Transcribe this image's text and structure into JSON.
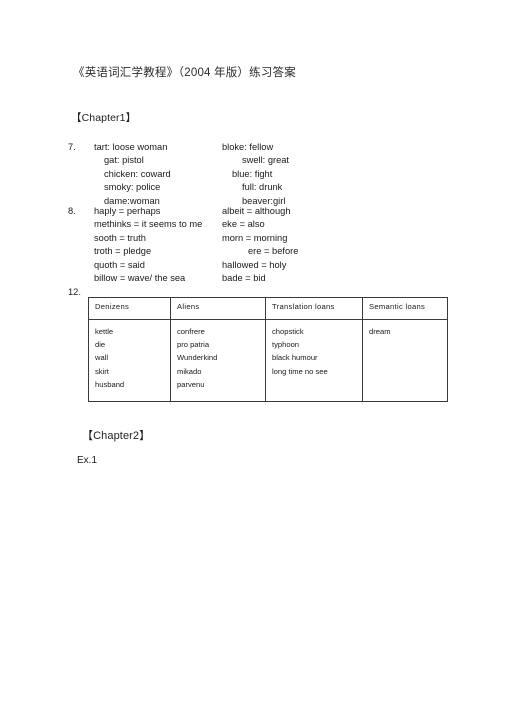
{
  "document": {
    "title": "《英语词汇学教程》（2004 年版）练习答案"
  },
  "chapter1": {
    "heading": "【Chapter1】",
    "exercises": [
      {
        "number": "7.",
        "rows": [
          {
            "left": "tart: loose woman",
            "left_indent": 0,
            "right": "bloke: fellow",
            "right_indent": 0
          },
          {
            "left": "gat: pistol",
            "left_indent": 1,
            "right": "swell: great",
            "right_indent": 1
          },
          {
            "left": "chicken: coward",
            "left_indent": 1,
            "right": "blue: fight",
            "right_indent": 0
          },
          {
            "left": "smoky: police",
            "left_indent": 1,
            "right": "full: drunk",
            "right_indent": 1
          },
          {
            "left": "dame:woman",
            "left_indent": 1,
            "right": "beaver:girl",
            "right_indent": 1
          }
        ]
      },
      {
        "number": "8.",
        "rows": [
          {
            "left": "haply = perhaps",
            "left_indent": 0,
            "right": "albeit = although",
            "right_indent": 0
          },
          {
            "left": "methinks = it seems to me",
            "left_indent": 0,
            "right": "eke = also",
            "right_indent": 0
          },
          {
            "left": "sooth = truth",
            "left_indent": 0,
            "right": "morn = morning",
            "right_indent": 0
          },
          {
            "left": "troth = pledge",
            "left_indent": 0,
            "right": "ere = before",
            "right_indent": 2
          },
          {
            "left": "quoth = said",
            "left_indent": 0,
            "right": "hallowed = holy",
            "right_indent": 0
          },
          {
            "left": "billow  = wave/ the sea",
            "left_indent": 0,
            "right": "bade = bid",
            "right_indent": 0
          }
        ]
      }
    ],
    "table_exercise": {
      "number": "12.",
      "columns": [
        "Denizens",
        "Aliens",
        "Translation  loans",
        "Semantic  loans"
      ],
      "cells": [
        [
          "kettle",
          "die",
          "wall",
          "skirt",
          "husband"
        ],
        [
          "confrere",
          "pro patria",
          "Wunderkind",
          "mikado",
          "parvenu"
        ],
        [
          "chopstick",
          "typhoon",
          "black humour",
          "long time no see"
        ],
        [
          "dream"
        ]
      ]
    }
  },
  "chapter2": {
    "heading": "【Chapter2】",
    "exercise_label": "Ex.1"
  },
  "colors": {
    "page_background": "#ffffff",
    "text": "#1a1a1a",
    "table_border": "#3a3a3a"
  }
}
